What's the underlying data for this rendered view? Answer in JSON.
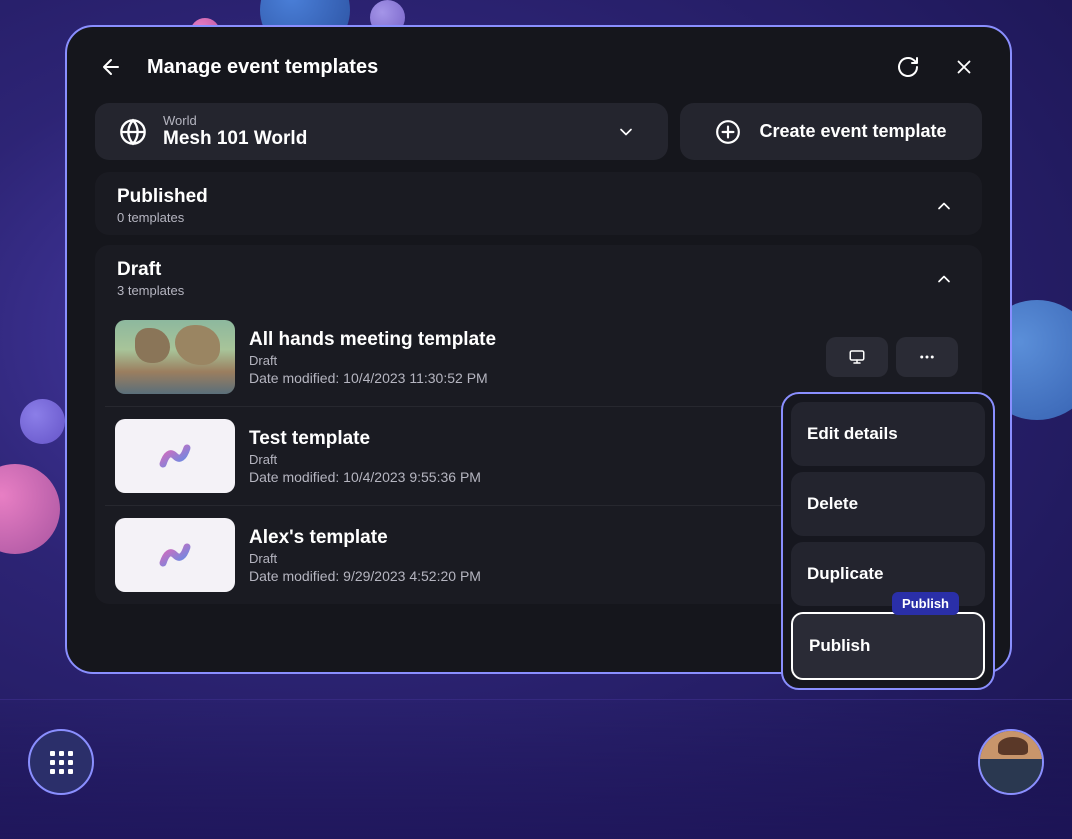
{
  "modal": {
    "title": "Manage event templates"
  },
  "worldSelector": {
    "label": "World",
    "name": "Mesh 101 World"
  },
  "createButton": {
    "label": "Create event template"
  },
  "sections": {
    "published": {
      "title": "Published",
      "subtitle": "0 templates"
    },
    "draft": {
      "title": "Draft",
      "subtitle": "3 templates"
    }
  },
  "datePrefix": "Date modified: ",
  "templates": [
    {
      "name": "All hands meeting template",
      "status": "Draft",
      "date": "10/4/2023 11:30:52 PM"
    },
    {
      "name": "Test template",
      "status": "Draft",
      "date": "10/4/2023 9:55:36 PM"
    },
    {
      "name": "Alex's template",
      "status": "Draft",
      "date": "9/29/2023 4:52:20 PM"
    }
  ],
  "contextMenu": {
    "items": [
      {
        "label": "Edit details"
      },
      {
        "label": "Delete"
      },
      {
        "label": "Duplicate"
      },
      {
        "label": "Publish"
      }
    ],
    "tooltip": "Publish"
  }
}
